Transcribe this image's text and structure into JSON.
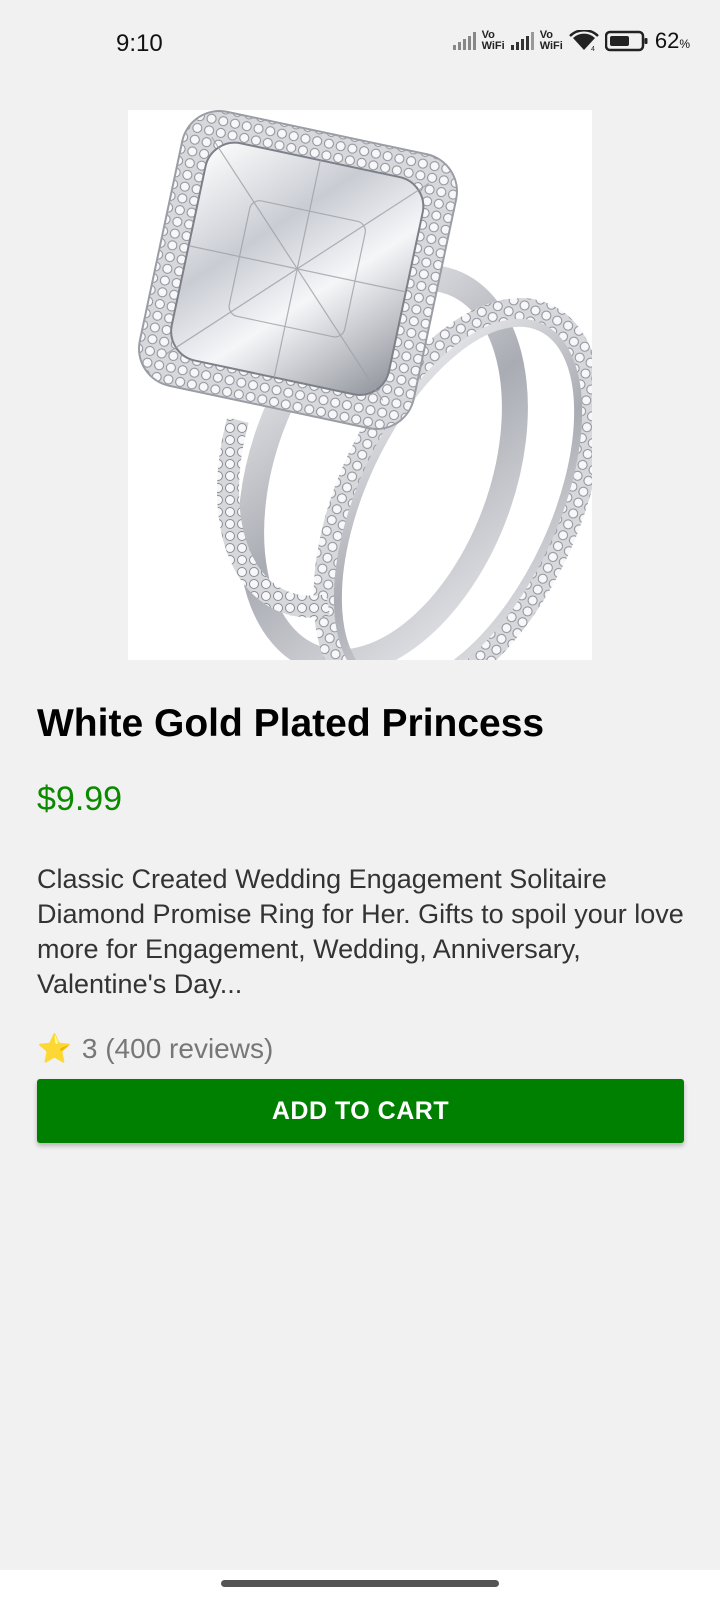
{
  "status_bar": {
    "time": "9:10",
    "vowifi_1": [
      "Vo",
      "WiFi"
    ],
    "vowifi_2": [
      "Vo",
      "WiFi"
    ],
    "battery_percent": "62",
    "battery_unit": "%",
    "battery_level": 0.62
  },
  "product": {
    "image_name": "ring-product-image",
    "title": "White Gold Plated Princess",
    "price": "$9.99",
    "price_color": "#0b8a00",
    "description": "Classic Created Wedding Engagement Solitaire Diamond Promise Ring for Her. Gifts to spoil your love more for Engagement, Wedding, Anniversary, Valentine's Day...",
    "rating": {
      "icon": "star-icon",
      "star_glyph": "⭐",
      "text": "3 (400 reviews)"
    }
  },
  "actions": {
    "add_to_cart_label": "ADD TO CART",
    "button_color": "#008000"
  }
}
